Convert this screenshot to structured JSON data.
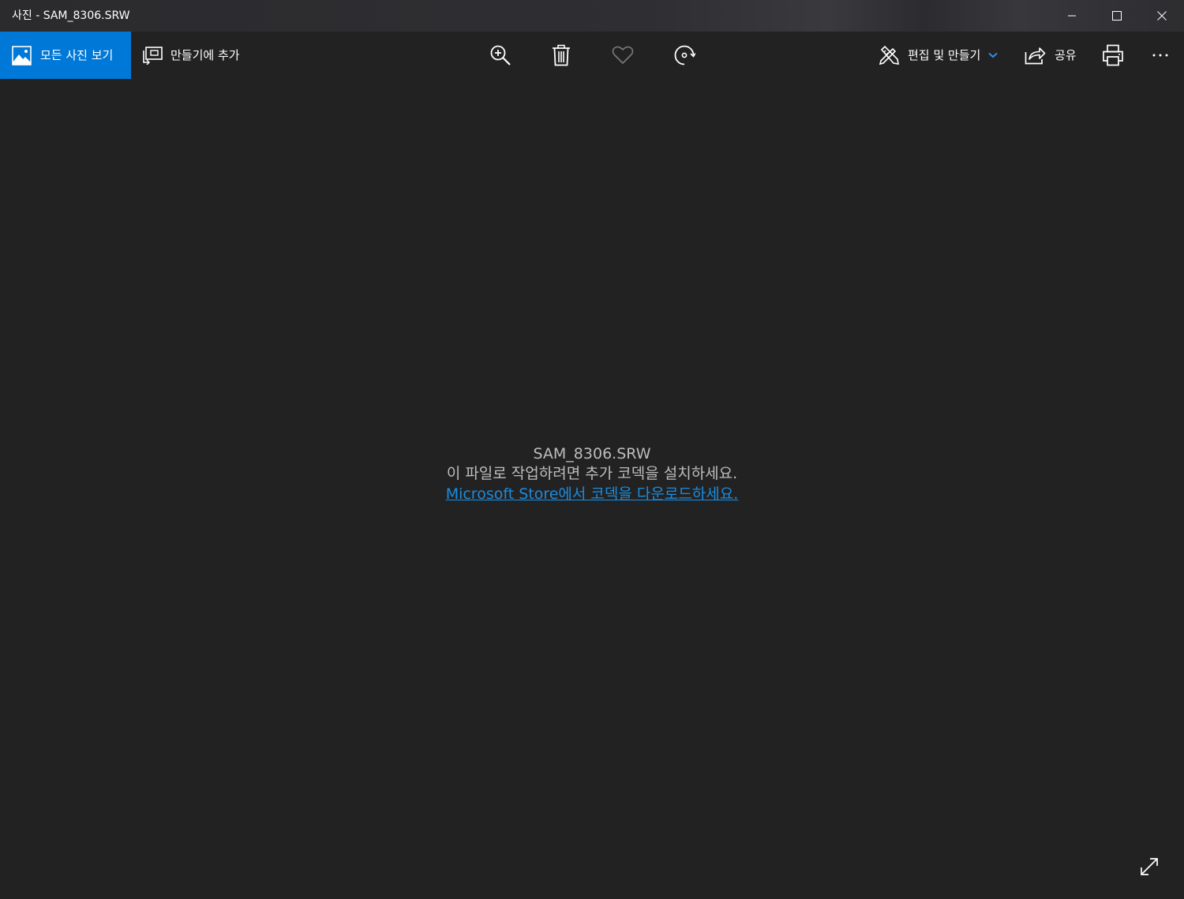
{
  "window": {
    "title": "사진 - SAM_8306.SRW"
  },
  "window_controls": {
    "minimize_icon": "minimize-icon",
    "maximize_icon": "maximize-icon",
    "close_icon": "close-icon"
  },
  "toolbar": {
    "view_all_label": "모든 사진 보기",
    "add_to_creation_label": "만들기에 추가",
    "zoom_icon": "zoom-in-icon",
    "delete_icon": "trash-icon",
    "favorite_icon": "heart-icon",
    "rotate_icon": "rotate-icon",
    "edit_create_label": "편집 및 만들기",
    "share_label": "공유",
    "print_icon": "print-icon",
    "more_icon": "more-icon"
  },
  "message": {
    "filename": "SAM_8306.SRW",
    "instruction": "이 파일로 작업하려면 추가 코덱을 설치하세요.",
    "store_link": "Microsoft Store에서 코덱을 다운로드하세요."
  },
  "colors": {
    "accent": "#0078d7",
    "link": "#1a8ce0",
    "background": "#222222"
  }
}
